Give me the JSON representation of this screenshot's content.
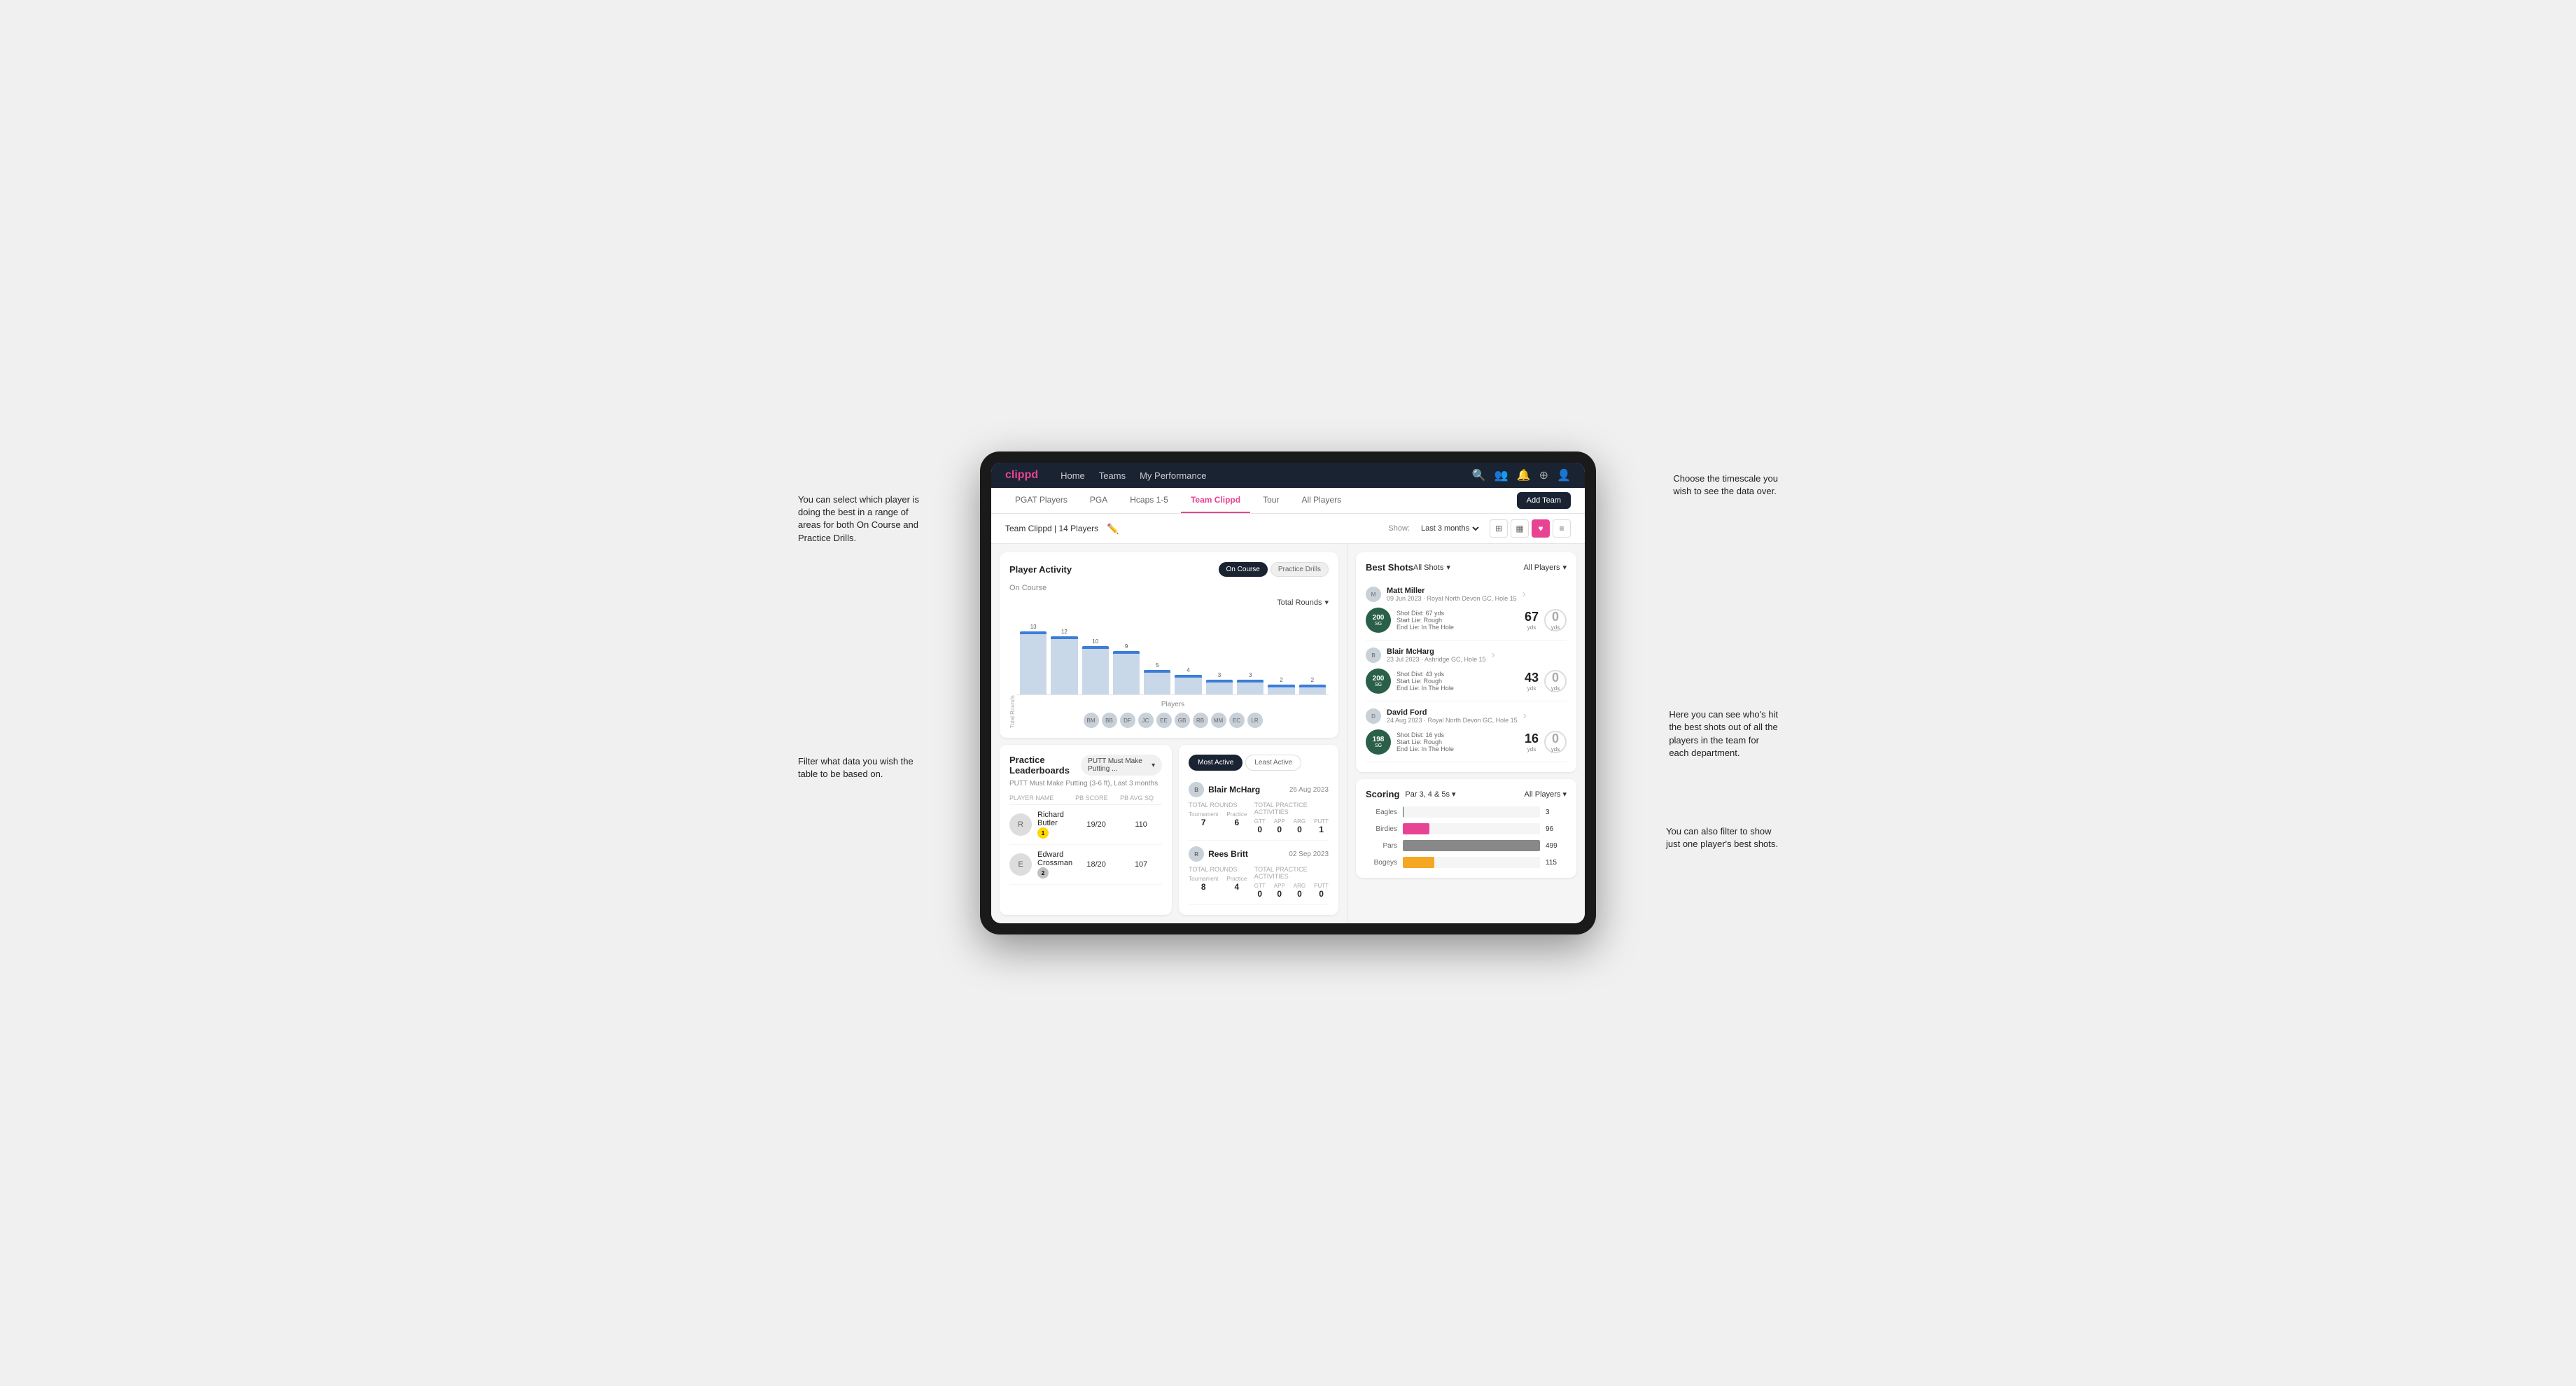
{
  "annotations": {
    "top_left": "You can select which player is\ndoing the best in a range of\nareas for both On Course and\nPractice Drills.",
    "top_right": "Choose the timescale you\nwish to see the data over.",
    "bottom_left": "Filter what data you wish the\ntable to be based on.",
    "bottom_right1": "Here you can see who's hit\nthe best shots out of all the\nplayers in the team for\neach department.",
    "bottom_right2": "You can also filter to show\njust one player's best shots."
  },
  "nav": {
    "logo": "clippd",
    "links": [
      "Home",
      "Teams",
      "My Performance"
    ],
    "icons": [
      "search",
      "users",
      "bell",
      "plus",
      "user"
    ]
  },
  "sub_nav": {
    "tabs": [
      "PGAT Players",
      "PGA",
      "Hcaps 1-5",
      "Team Clippd",
      "Tour",
      "All Players"
    ],
    "active": "Team Clippd",
    "add_button": "Add Team"
  },
  "team_header": {
    "name": "Team Clippd | 14 Players",
    "show_label": "Show:",
    "time_range": "Last 3 months",
    "views": [
      "grid",
      "grid2",
      "heart",
      "list"
    ]
  },
  "player_activity": {
    "title": "Player Activity",
    "toggle_options": [
      "On Course",
      "Practice Drills"
    ],
    "active_toggle": "On Course",
    "section": "On Course",
    "chart_filter": "Total Rounds",
    "x_label": "Players",
    "y_label": "Total Rounds",
    "bars": [
      {
        "name": "B. McHarg",
        "value": 13
      },
      {
        "name": "B. Britt",
        "value": 12
      },
      {
        "name": "D. Ford",
        "value": 10
      },
      {
        "name": "J. Coles",
        "value": 9
      },
      {
        "name": "E. Ebert",
        "value": 5
      },
      {
        "name": "G. Billingham",
        "value": 4
      },
      {
        "name": "R. Butler",
        "value": 3
      },
      {
        "name": "M. Miller",
        "value": 3
      },
      {
        "name": "E. Crossman",
        "value": 2
      },
      {
        "name": "L. Robertson",
        "value": 2
      }
    ]
  },
  "practice_leaderboards": {
    "title": "Practice Leaderboards",
    "filter": "PUTT Must Make Putting ...",
    "subtitle": "PUTT Must Make Putting (3-6 ft), Last 3 months",
    "columns": [
      "PLAYER NAME",
      "PB SCORE",
      "PB AVG SQ"
    ],
    "players": [
      {
        "name": "Richard Butler",
        "rank": 1,
        "pb_score": "19/20",
        "pb_avg": "110"
      },
      {
        "name": "Edward Crossman",
        "rank": 2,
        "pb_score": "18/20",
        "pb_avg": "107"
      }
    ]
  },
  "most_active": {
    "tabs": [
      "Most Active",
      "Least Active"
    ],
    "active_tab": "Most Active",
    "players": [
      {
        "name": "Blair McHarg",
        "date": "26 Aug 2023",
        "rounds_label": "Total Rounds",
        "tournament": 7,
        "practice": 6,
        "practice_activities_label": "Total Practice Activities",
        "gtt": 0,
        "app": 0,
        "arg": 0,
        "putt": 1
      },
      {
        "name": "Rees Britt",
        "date": "02 Sep 2023",
        "rounds_label": "Total Rounds",
        "tournament": 8,
        "practice": 4,
        "practice_activities_label": "Total Practice Activities",
        "gtt": 0,
        "app": 0,
        "arg": 0,
        "putt": 0
      }
    ]
  },
  "best_shots": {
    "title": "Best Shots",
    "filter1": "All Shots",
    "filter2": "All Players",
    "players": [
      {
        "name": "Matt Miller",
        "date": "09 Jun 2023",
        "course": "Royal North Devon GC",
        "hole": "Hole 15",
        "badge_num": 200,
        "badge_sub": "SG",
        "shot_dist": "Shot Dist: 67 yds",
        "start_lie": "Start Lie: Rough",
        "end_lie": "End Lie: In The Hole",
        "yards1": 67,
        "yards2": 0
      },
      {
        "name": "Blair McHarg",
        "date": "23 Jul 2023",
        "course": "Ashridge GC",
        "hole": "Hole 15",
        "badge_num": 200,
        "badge_sub": "SG",
        "shot_dist": "Shot Dist: 43 yds",
        "start_lie": "Start Lie: Rough",
        "end_lie": "End Lie: In The Hole",
        "yards1": 43,
        "yards2": 0
      },
      {
        "name": "David Ford",
        "date": "24 Aug 2023",
        "course": "Royal North Devon GC",
        "hole": "Hole 15",
        "badge_num": 198,
        "badge_sub": "SG",
        "shot_dist": "Shot Dist: 16 yds",
        "start_lie": "Start Lie: Rough",
        "end_lie": "End Lie: In The Hole",
        "yards1": 16,
        "yards2": 0
      }
    ]
  },
  "scoring": {
    "title": "Scoring",
    "filter1": "Par 3, 4 & 5s",
    "filter2": "All Players",
    "bars": [
      {
        "label": "Eagles",
        "value": 3,
        "max": 500,
        "color": "#2a6049"
      },
      {
        "label": "Birdies",
        "value": 96,
        "max": 500,
        "color": "#e84393"
      },
      {
        "label": "Pars",
        "value": 499,
        "max": 500,
        "color": "#888"
      },
      {
        "label": "Bogeys",
        "value": 115,
        "max": 500,
        "color": "#f5a623"
      }
    ]
  }
}
